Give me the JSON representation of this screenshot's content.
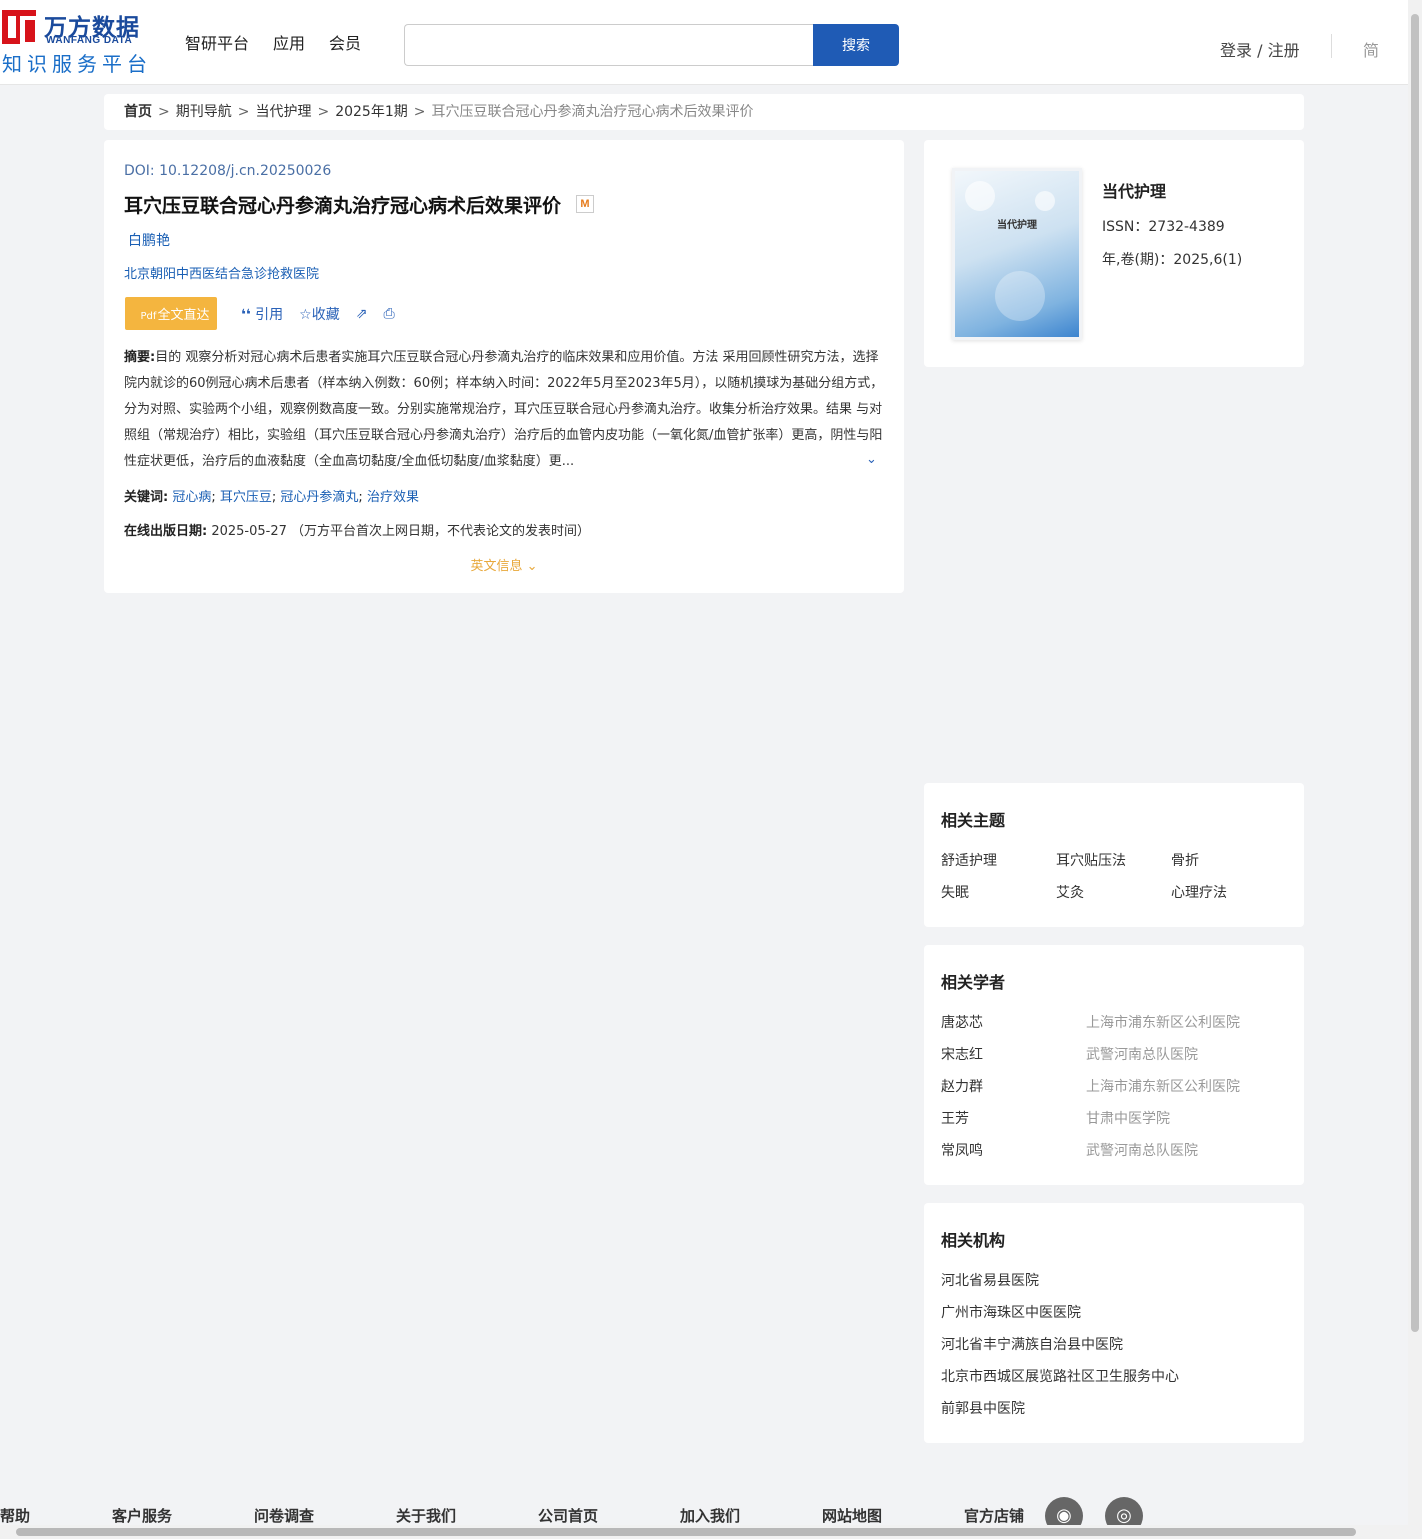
{
  "header": {
    "logo_cn": "万方数据",
    "logo_en": "WANFANG DATA",
    "logo_sub": "知识服务平台",
    "nav": [
      "智研平台",
      "应用",
      "会员"
    ],
    "search_placeholder": "",
    "search_button": "搜索",
    "login": "登录 / 注册",
    "lang": "简"
  },
  "breadcrumb": [
    "首页",
    "期刊导航",
    "当代护理",
    "2025年1期"
  ],
  "breadcrumb_current": "耳穴压豆联合冠心丹参滴丸治疗冠心病术后效果评价",
  "article": {
    "doi_label": "DOI: ",
    "doi": "10.12208/j.cn.20250026",
    "title": "耳穴压豆联合冠心丹参滴丸治疗冠心病术后效果评价",
    "badge": "M",
    "author": "白鹏艳",
    "organization": "北京朝阳中西医结合急诊抢救医院",
    "fulltext_button": "全文直达",
    "fulltext_icon": "Pdf",
    "actions": {
      "cite": "引用",
      "favorite": "收藏"
    },
    "abstract_label": "摘要:",
    "abstract": "目的 观察分析对冠心病术后患者实施耳穴压豆联合冠心丹参滴丸治疗的临床效果和应用价值。方法 采用回顾性研究方法，选择院内就诊的60例冠心病术后患者（样本纳入例数：60例；样本纳入时间：2022年5月至2023年5月），以随机摸球为基础分组方式，分为对照、实验两个小组，观察例数高度一致。分别实施常规治疗，耳穴压豆联合冠心丹参滴丸治疗。收集分析治疗效果。结果 与对照组（常规治疗）相比，实验组（耳穴压豆联合冠心丹参滴丸治疗）治疗后的血管内皮功能（一氧化氮/血管扩张率）更高，阴性与阳性症状更低，治疗后的血液黏度（全血高切黏度/全血低切黏度/血浆黏度）更...",
    "keywords_label": "关键词:",
    "keywords": [
      "冠心病",
      "耳穴压豆",
      "冠心丹参滴丸",
      "治疗效果"
    ],
    "pubdate_label": "在线出版日期:",
    "pubdate": "2025-05-27",
    "pubdate_note": "（万方平台首次上网日期，不代表论文的发表时间）",
    "english_info": "英文信息"
  },
  "journal": {
    "name": "当代护理",
    "cover_title": "当代护理",
    "issn": "ISSN：2732-4389",
    "volume": "年,卷(期)：2025,6(1)"
  },
  "related_topics": {
    "title": "相关主题",
    "items": [
      "舒适护理",
      "耳穴贴压法",
      "骨折",
      "失眠",
      "艾灸",
      "心理疗法"
    ]
  },
  "related_scholars": {
    "title": "相关学者",
    "items": [
      {
        "name": "唐苾芯",
        "org": "上海市浦东新区公利医院"
      },
      {
        "name": "宋志红",
        "org": "武警河南总队医院"
      },
      {
        "name": "赵力群",
        "org": "上海市浦东新区公利医院"
      },
      {
        "name": "王芳",
        "org": "甘肃中医学院"
      },
      {
        "name": "常凤鸣",
        "org": "武警河南总队医院"
      }
    ]
  },
  "related_orgs": {
    "title": "相关机构",
    "items": [
      "河北省易县医院",
      "广州市海珠区中医医院",
      "河北省丰宁满族自治县中医院",
      "北京市西城区展览路社区卫生服务中心",
      "前郭县中医院"
    ]
  },
  "footer": [
    "帮助",
    "客户服务",
    "问卷调查",
    "关于我们",
    "公司首页",
    "加入我们",
    "网站地图",
    "官方店铺"
  ],
  "footer_icons": [
    "weibo-icon",
    "wechat-icon"
  ]
}
